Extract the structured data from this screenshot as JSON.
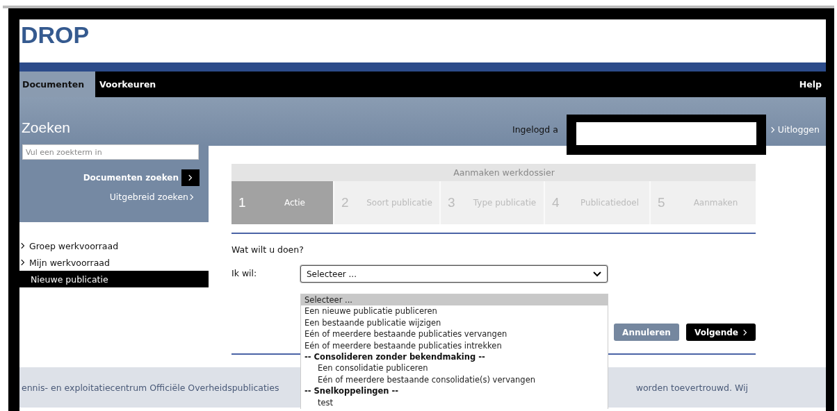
{
  "logo": "DROP",
  "nav": {
    "tabs": [
      {
        "label": "Documenten",
        "selected": true
      },
      {
        "label": "Voorkeuren",
        "selected": false
      }
    ],
    "help": "Help"
  },
  "header": {
    "title": "Zoeken",
    "logged_in_label": "Ingelogd a",
    "logout": "Uitloggen"
  },
  "sidebar": {
    "search": {
      "placeholder": "Vul een zoekterm in"
    },
    "search_button": "Documenten zoeken",
    "advanced_link": "Uitgebreid zoeken",
    "items": [
      {
        "label": "Groep werkvoorraad",
        "selected": false
      },
      {
        "label": "Mijn werkvoorraad",
        "selected": false
      },
      {
        "label": "Nieuwe publicatie",
        "selected": true
      }
    ]
  },
  "wizard": {
    "title": "Aanmaken werkdossier",
    "steps": [
      {
        "number": "1",
        "label": "Actie",
        "selected": true
      },
      {
        "number": "2",
        "label": "Soort publicatie",
        "selected": false
      },
      {
        "number": "3",
        "label": "Type publicatie",
        "selected": false
      },
      {
        "number": "4",
        "label": "Publicatiedoel",
        "selected": false
      },
      {
        "number": "5",
        "label": "Aanmaken",
        "selected": false
      }
    ]
  },
  "question": "Wat wilt u doen?",
  "field": {
    "label": "Ik wil:",
    "value": "Selecteer ...",
    "expanded": true,
    "options": [
      {
        "label": "Selecteer ...",
        "kind": "option",
        "selected": true
      },
      {
        "label": "Een nieuwe publicatie publiceren",
        "kind": "option",
        "selected": false
      },
      {
        "label": "Een bestaande publicatie wijzigen",
        "kind": "option",
        "selected": false
      },
      {
        "label": "Eén of meerdere bestaande publicaties vervangen",
        "kind": "option",
        "selected": false
      },
      {
        "label": "Eén of meerdere bestaande publicaties intrekken",
        "kind": "option",
        "selected": false
      },
      {
        "label": "-- Consolideren zonder bekendmaking --",
        "kind": "group",
        "selected": false
      },
      {
        "label": "Een consolidatie publiceren",
        "kind": "suboption",
        "selected": false
      },
      {
        "label": "Eén of meerdere bestaande consolidatie(s) vervangen",
        "kind": "suboption",
        "selected": false
      },
      {
        "label": "-- Snelkoppelingen --",
        "kind": "group",
        "selected": false
      },
      {
        "label": "test",
        "kind": "suboption",
        "selected": false
      }
    ]
  },
  "buttons": [
    {
      "label": "Annuleren",
      "kind": "secondary"
    },
    {
      "label": "Volgende",
      "kind": "primary"
    }
  ],
  "footer": {
    "left": "ennis- en exploitatiecentrum Officiële Overheidspublicaties",
    "right": "worden toevertrouwd. Wij"
  }
}
